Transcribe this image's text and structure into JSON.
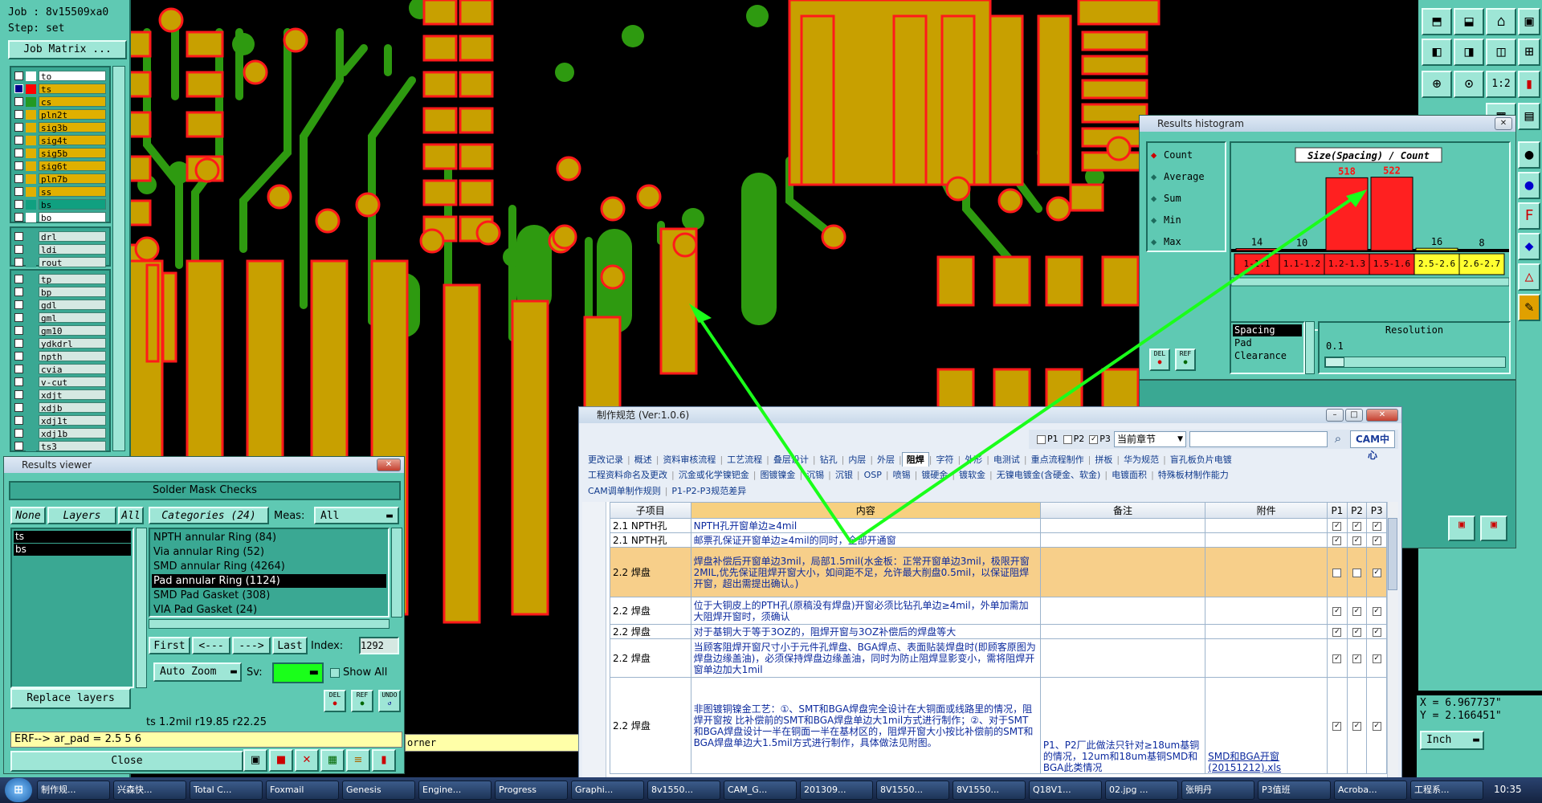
{
  "job": {
    "job_label": "Job : 8v15509xa0",
    "step_label": "Step: set",
    "matrix_button": "Job Matrix ..."
  },
  "layers": {
    "group1": [
      {
        "name": "to",
        "color": "#ffffff",
        "selected": false
      },
      {
        "name": "ts",
        "color": "#ff0000",
        "selected": true
      },
      {
        "name": "cs",
        "color": "#229922",
        "selected": false
      },
      {
        "name": "pln2t",
        "color": "#e0b000",
        "selected": false
      },
      {
        "name": "sig3b",
        "color": "#e0b000",
        "selected": false
      },
      {
        "name": "sig4t",
        "color": "#e0b000",
        "selected": false
      },
      {
        "name": "sig5b",
        "color": "#e0b000",
        "selected": false
      },
      {
        "name": "sig6t",
        "color": "#e0b000",
        "selected": false
      },
      {
        "name": "pln7b",
        "color": "#e0b000",
        "selected": false
      },
      {
        "name": "ss",
        "color": "#e0b000",
        "selected": false
      },
      {
        "name": "bs",
        "color": "#10a080",
        "selected": false
      },
      {
        "name": "bo",
        "color": "#ffffff",
        "selected": false
      }
    ],
    "group2": [
      {
        "name": "drl"
      },
      {
        "name": "ldi"
      },
      {
        "name": "rout"
      }
    ],
    "group3": [
      {
        "name": "tp"
      },
      {
        "name": "bp"
      },
      {
        "name": "gdl"
      },
      {
        "name": "gml"
      },
      {
        "name": "gm10"
      },
      {
        "name": "ydkdrl"
      },
      {
        "name": "npth"
      },
      {
        "name": "cvia"
      },
      {
        "name": "v-cut"
      },
      {
        "name": "xdjt"
      },
      {
        "name": "xdjb"
      },
      {
        "name": "xdj1t"
      },
      {
        "name": "xdj1b"
      },
      {
        "name": "ts3"
      }
    ]
  },
  "results_viewer": {
    "title": "Results viewer",
    "header": "Solder Mask Checks",
    "none_btn": "None",
    "layers_btn": "Layers",
    "all_btn": "All",
    "categories_btn": "Categories (24)",
    "meas_label": "Meas:",
    "meas_value": "All",
    "layer_list": [
      "ts",
      "bs"
    ],
    "categories": [
      {
        "label": "NPTH annular Ring (84)",
        "selected": false
      },
      {
        "label": "Via annular Ring (52)",
        "selected": false
      },
      {
        "label": "SMD annular Ring (4264)",
        "selected": false
      },
      {
        "label": "Pad annular Ring (1124)",
        "selected": true
      },
      {
        "label": "SMD Pad Gasket (308)",
        "selected": false
      },
      {
        "label": "VIA Pad Gasket (24)",
        "selected": false
      }
    ],
    "first_btn": "First",
    "prev_btn": "<---",
    "next_btn": "--->",
    "last_btn": "Last",
    "index_label": "Index:",
    "index_value": "1292",
    "autozoom_btn": "Auto Zoom",
    "sv_label": "Sv:",
    "show_all_label": "Show All",
    "replace_btn": "Replace layers",
    "del_btn": "DEL",
    "ref_btn": "REF",
    "undo_btn": "UNDO",
    "status_line": "ts 1.2mil  r19.85  r22.25",
    "erf_line": "ERF--> ar_pad = 2.5 5 6",
    "close_btn": "Close"
  },
  "histogram": {
    "title": "Results histogram",
    "modes": [
      {
        "label": "Count",
        "selected": true
      },
      {
        "label": "Average",
        "selected": false
      },
      {
        "label": "Sum",
        "selected": false
      },
      {
        "label": "Min",
        "selected": false
      },
      {
        "label": "Max",
        "selected": false
      }
    ],
    "chart_title": "Size(Spacing) / Count",
    "del_btn": "DEL",
    "ref_btn": "REF",
    "list_items": [
      "Spacing",
      "Pad",
      "Clearance"
    ],
    "resolution_label": "Resolution",
    "resolution_value": "0.1",
    "chart_data": {
      "type": "bar",
      "categories": [
        "1-1.1",
        "1.1-1.2",
        "1.2-1.3",
        "1.5-1.6",
        "2.5-2.6",
        "2.6-2.7"
      ],
      "values": [
        14,
        10,
        518,
        522,
        16,
        8
      ],
      "value_labels": [
        "14",
        "10",
        "518",
        "522",
        "16",
        "8"
      ],
      "bin_colors": [
        "#ff2020",
        "#ff2020",
        "#ff2020",
        "#ff2020",
        "#ffff30",
        "#ffff30"
      ],
      "title": "Size(Spacing) / Count",
      "ylim": [
        0,
        560
      ]
    }
  },
  "coords": {
    "x_label": "X = 6.967737\"",
    "y_label": "Y = 2.166451\"",
    "units": "Inch"
  },
  "corner_text": "orner",
  "spec": {
    "title": "制作规范 (Ver:1.0.6)",
    "filters": [
      {
        "label": "P1",
        "checked": false
      },
      {
        "label": "P2",
        "checked": false
      },
      {
        "label": "P3",
        "checked": true
      }
    ],
    "scope_value": "当前章节",
    "logo": "CAM中心",
    "tabs_row1": [
      "更改记录",
      "概述",
      "资料审核流程",
      "工艺流程",
      "叠层设计",
      "钻孔",
      "内层",
      "外层",
      "阻焊",
      "字符",
      "外形",
      "电测试",
      "重点流程制作",
      "拼板",
      "华为规范",
      "盲孔板负片电镀"
    ],
    "active_tab": "阻焊",
    "tabs_row2": [
      "工程资料命名及更改",
      "沉金或化学镍钯金",
      "图镀镍金",
      "沉锡",
      "沉银",
      "OSP",
      "喷锡",
      "镀硬金",
      "镀软金",
      "无镍电镀金(含硬金、软金)",
      "电镀面积",
      "特殊板材制作能力"
    ],
    "tabs_row3": [
      "CAM调单制作规则",
      "P1-P2-P3规范差异"
    ],
    "columns": [
      "子项目",
      "内容",
      "备注",
      "附件",
      "P1",
      "P2",
      "P3"
    ],
    "rows": [
      {
        "item": "2.1 NPTH孔",
        "content": "NPTH孔开窗单边≥4mil",
        "note": "",
        "attach": "",
        "p1": true,
        "p2": true,
        "p3": true,
        "highlight": false
      },
      {
        "item": "2.1 NPTH孔",
        "content": "邮票孔保证开窗单边≥4mil的同时，全部开通窗",
        "note": "",
        "attach": "",
        "p1": true,
        "p2": true,
        "p3": true,
        "highlight": false
      },
      {
        "item": "2.2 焊盘",
        "content": "焊盘补偿后开窗单边3mil，局部1.5mil(水金板：正常开窗单边3mil，极限开窗2MIL,优先保证阻焊开窗大小，如间距不足，允许最大削盘0.5mil，以保证阻焊开窗，超出需提出确认。)",
        "note": "",
        "attach": "",
        "p1": false,
        "p2": false,
        "p3": true,
        "highlight": true
      },
      {
        "item": "2.2 焊盘",
        "content": "位于大铜皮上的PTH孔(原稿没有焊盘)开窗必须比钻孔单边≥4mil，外单加需加大阻焊开窗时，须确认",
        "note": "",
        "attach": "",
        "p1": true,
        "p2": true,
        "p3": true,
        "highlight": false
      },
      {
        "item": "2.2 焊盘",
        "content": "对于基铜大于等于3OZ的，阻焊开窗与3OZ补偿后的焊盘等大",
        "note": "",
        "attach": "",
        "p1": true,
        "p2": true,
        "p3": true,
        "highlight": false
      },
      {
        "item": "2.2 焊盘",
        "content": "当顾客阻焊开窗尺寸小于元件孔焊盘、BGA焊点、表面贴装焊盘时(即顾客原图为焊盘边缘盖油)，必须保持焊盘边缘盖油，同时为防止阻焊显影变小，需将阻焊开窗单边加大1mil",
        "note": "",
        "attach": "",
        "p1": true,
        "p2": true,
        "p3": true,
        "highlight": false
      },
      {
        "item": "2.2 焊盘",
        "content": "非图镀铜镍金工艺：①、SMT和BGA焊盘完全设计在大铜面或线路里的情况，阻焊开窗按 比补偿前的SMT和BGA焊盘单边大1mil方式进行制作；②、对于SMT和BGA焊盘设计一半在铜面一半在基材区的，阻焊开窗大小按比补偿前的SMT和BGA焊盘单边大1.5mil方式进行制作，具体做法见附图。",
        "note": "P1、P2厂此做法只针对≥18um基铜的情况，12um和18um基铜SMD和BGA此类情况",
        "attach": "SMD和BGA开窗(20151212).xls",
        "p1": true,
        "p2": true,
        "p3": true,
        "highlight": false
      }
    ]
  },
  "taskbar": {
    "items": [
      "制作规...",
      "兴森快...",
      "Total C...",
      "Foxmail",
      "Genesis",
      "Engine...",
      "Progress",
      "Graphi...",
      "8v1550...",
      "CAM_G...",
      "201309...",
      "8V1550...",
      "8V1550...",
      "Q18V1...",
      "02.jpg ...",
      "张明丹",
      "P3值班",
      "Acroba...",
      "工程系..."
    ],
    "clock": "10:35"
  }
}
